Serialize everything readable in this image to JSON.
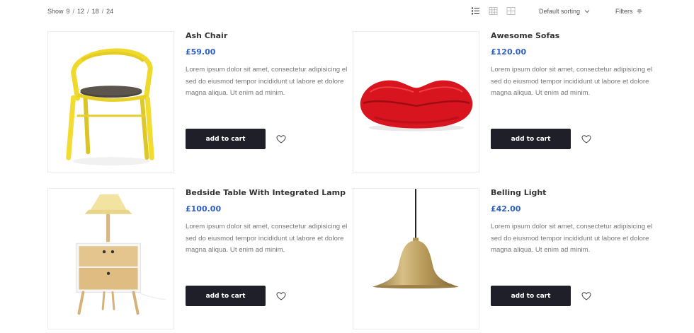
{
  "toolbar": {
    "show_label": "Show",
    "show_options": [
      "9",
      "12",
      "18",
      "24"
    ],
    "sorting_label": "Default sorting",
    "filters_label": "Filters"
  },
  "products": [
    {
      "name": "Ash Chair",
      "price": "£59.00",
      "description": "Lorem ipsum dolor sit amet, consectetur adipisicing el sed do eiusmod tempor incididunt ut labore et dolore magna aliqua. Ut enim ad minim.",
      "button_label": "add to cart"
    },
    {
      "name": "Awesome Sofas",
      "price": "£120.00",
      "description": "Lorem ipsum dolor sit amet, consectetur adipisicing el sed do eiusmod tempor incididunt ut labore et dolore magna aliqua. Ut enim ad minim.",
      "button_label": "add to cart"
    },
    {
      "name": "Bedside Table With Integrated Lamp",
      "price": "£100.00",
      "description": "Lorem ipsum dolor sit amet, consectetur adipisicing el sed do eiusmod tempor incididunt ut labore et dolore magna aliqua. Ut enim ad minim.",
      "button_label": "add to cart"
    },
    {
      "name": "Belling Light",
      "price": "£42.00",
      "description": "Lorem ipsum dolor sit amet, consectetur adipisicing el sed do eiusmod tempor incididunt ut labore et dolore magna aliqua. Ut enim ad minim.",
      "button_label": "add to cart"
    }
  ],
  "icons": {
    "list_view": "list-view-icon",
    "grid_view": "grid-view-icon",
    "large_grid_view": "large-grid-view-icon",
    "sort_dropdown": "chevron-down-icon",
    "filters": "filter-lines-icon",
    "wishlist": "heart-icon"
  },
  "colors": {
    "price": "#2f5fc4",
    "button_bg": "#1f1f29",
    "active_view_icon": "#333333",
    "inactive_view_icon": "#bbbbbb"
  }
}
